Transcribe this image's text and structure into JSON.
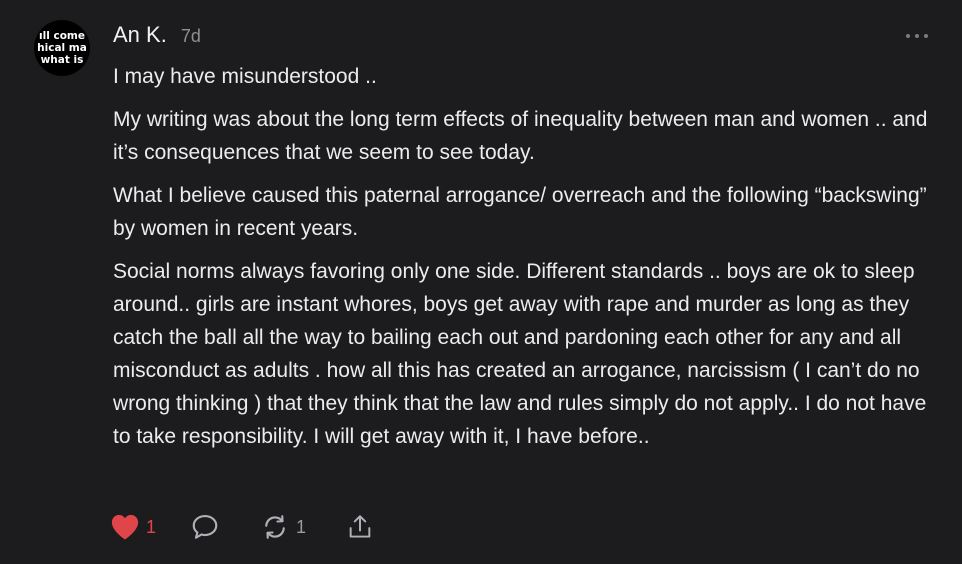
{
  "comment": {
    "author": "An K.",
    "age": "7d",
    "avatar_lines": [
      "ıll come",
      "hical ma",
      "what is"
    ],
    "paragraphs": [
      "I may have misunderstood ..",
      "My writing was about the long term effects of inequality between man and women .. and it’s consequences that we seem to see today.",
      "What I believe caused this paternal arrogance/ overreach and the following “backswing” by women in recent years.",
      "Social norms always favoring only one side. Different standards .. boys are ok to sleep around.. girls are instant whores, boys get away with rape and murder as long as they catch the ball all the way to bailing each out and pardoning each other for any and all misconduct as adults . how all this has created an arrogance, narcissism ( I can’t do no wrong thinking ) that they think that the law and rules simply do not apply.. I do not have to take responsibility. I will get away with it, I have before.."
    ]
  },
  "actions": {
    "like_count": "1",
    "restack_count": "1"
  },
  "icons": {
    "more": "more-horizontal-icon",
    "like": "heart-icon",
    "reply": "speech-bubble-icon",
    "restack": "restack-arrows-icon",
    "share": "share-upload-icon"
  },
  "colors": {
    "background": "#1c1c1e",
    "text": "#ececec",
    "muted": "#8e8e93",
    "like": "#e0454a"
  }
}
